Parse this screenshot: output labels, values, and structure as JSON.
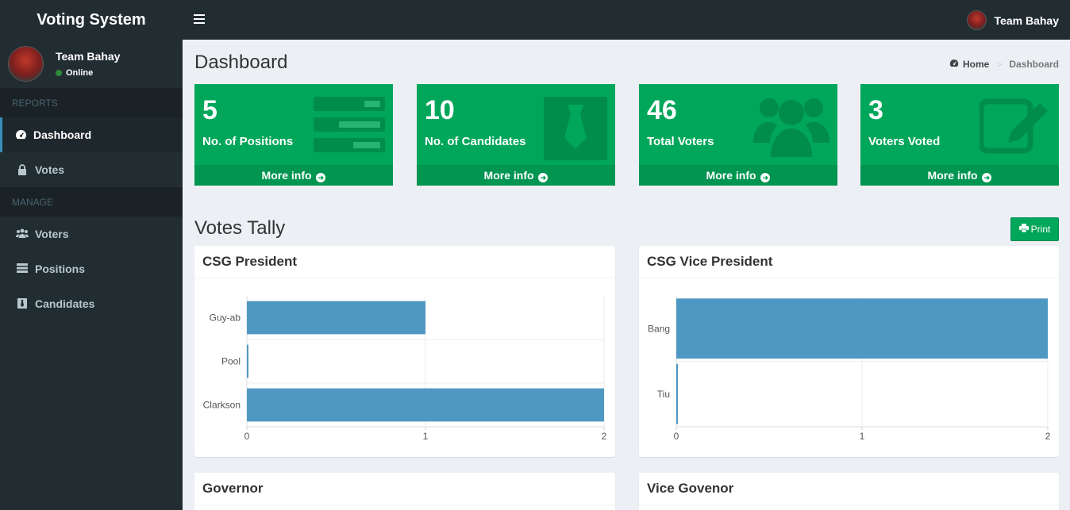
{
  "app": {
    "title": "Voting System"
  },
  "topbar": {
    "user_name": "Team Bahay"
  },
  "sidebar": {
    "user_name": "Team Bahay",
    "status": "Online",
    "reports_header": "REPORTS",
    "manage_header": "MANAGE",
    "items": [
      {
        "label": "Dashboard",
        "icon": "dashboard-icon"
      },
      {
        "label": "Votes",
        "icon": "lock-icon"
      },
      {
        "label": "Voters",
        "icon": "users-icon"
      },
      {
        "label": "Positions",
        "icon": "list-icon"
      },
      {
        "label": "Candidates",
        "icon": "candidate-icon"
      }
    ]
  },
  "page": {
    "title": "Dashboard",
    "breadcrumb_home": "Home",
    "breadcrumb_current": "Dashboard"
  },
  "stats": [
    {
      "value": "5",
      "label": "No. of Positions",
      "footer": "More info",
      "icon": "list-icon"
    },
    {
      "value": "10",
      "label": "No. of Candidates",
      "footer": "More info",
      "icon": "tie-icon"
    },
    {
      "value": "46",
      "label": "Total Voters",
      "footer": "More info",
      "icon": "users-icon"
    },
    {
      "value": "3",
      "label": "Voters Voted",
      "footer": "More info",
      "icon": "edit-icon"
    }
  ],
  "tally": {
    "title": "Votes Tally",
    "print_label": "Print"
  },
  "colors": {
    "green": "#00a65a",
    "bar": "#4f98c3",
    "sidebar": "#222d32"
  },
  "chart_data": [
    {
      "type": "bar",
      "orientation": "horizontal",
      "title": "CSG President",
      "categories": [
        "Guy-ab",
        "Pool",
        "Clarkson"
      ],
      "values": [
        1,
        0,
        2
      ],
      "xlim": [
        0,
        2
      ],
      "xticks": [
        0,
        1,
        2
      ]
    },
    {
      "type": "bar",
      "orientation": "horizontal",
      "title": "CSG Vice President",
      "categories": [
        "Bang",
        "Tiu"
      ],
      "values": [
        2,
        0
      ],
      "xlim": [
        0,
        2
      ],
      "xticks": [
        0,
        1,
        2
      ]
    },
    {
      "type": "bar",
      "orientation": "horizontal",
      "title": "Governor",
      "categories": [],
      "values": []
    },
    {
      "type": "bar",
      "orientation": "horizontal",
      "title": "Vice Govenor",
      "categories": [],
      "values": []
    }
  ]
}
